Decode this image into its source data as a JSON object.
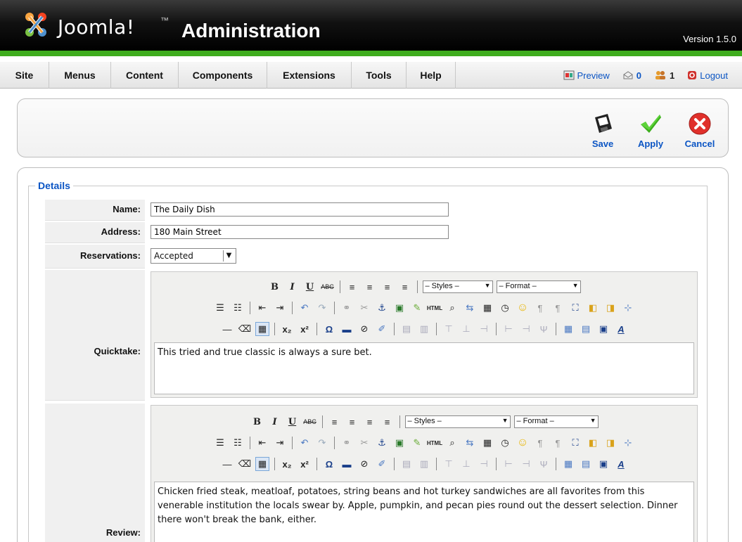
{
  "header": {
    "brand": "Joomla!",
    "brand_sup": "™",
    "admin": "Administration",
    "version": "Version 1.5.0"
  },
  "menu": {
    "items": [
      "Site",
      "Menus",
      "Content",
      "Components",
      "Extensions",
      "Tools",
      "Help"
    ],
    "preview": "Preview",
    "messages_count": "0",
    "users_count": "1",
    "logout": "Logout"
  },
  "toolbar": {
    "save": "Save",
    "apply": "Apply",
    "cancel": "Cancel"
  },
  "details": {
    "legend": "Details",
    "name_label": "Name:",
    "name_value": "The Daily Dish",
    "address_label": "Address:",
    "address_value": "180 Main Street",
    "reservations_label": "Reservations:",
    "reservations_value": "Accepted",
    "quicktake_label": "Quicktake:",
    "quicktake_value": "This tried and true classic is always a sure bet.",
    "review_label": "Review:",
    "review_value": "Chicken fried steak, meatloaf, potatoes, string beans and hot turkey sandwiches are all favorites from this venerable institution the locals swear by. Apple, pumpkin, and pecan pies round out the dessert selection. Dinner there won't break the bank, either."
  },
  "editor": {
    "styles_placeholder": "– Styles –",
    "format_placeholder": "– Format –"
  },
  "colors": {
    "accent_green": "#3fad1e",
    "link_blue": "#0b55c4"
  }
}
